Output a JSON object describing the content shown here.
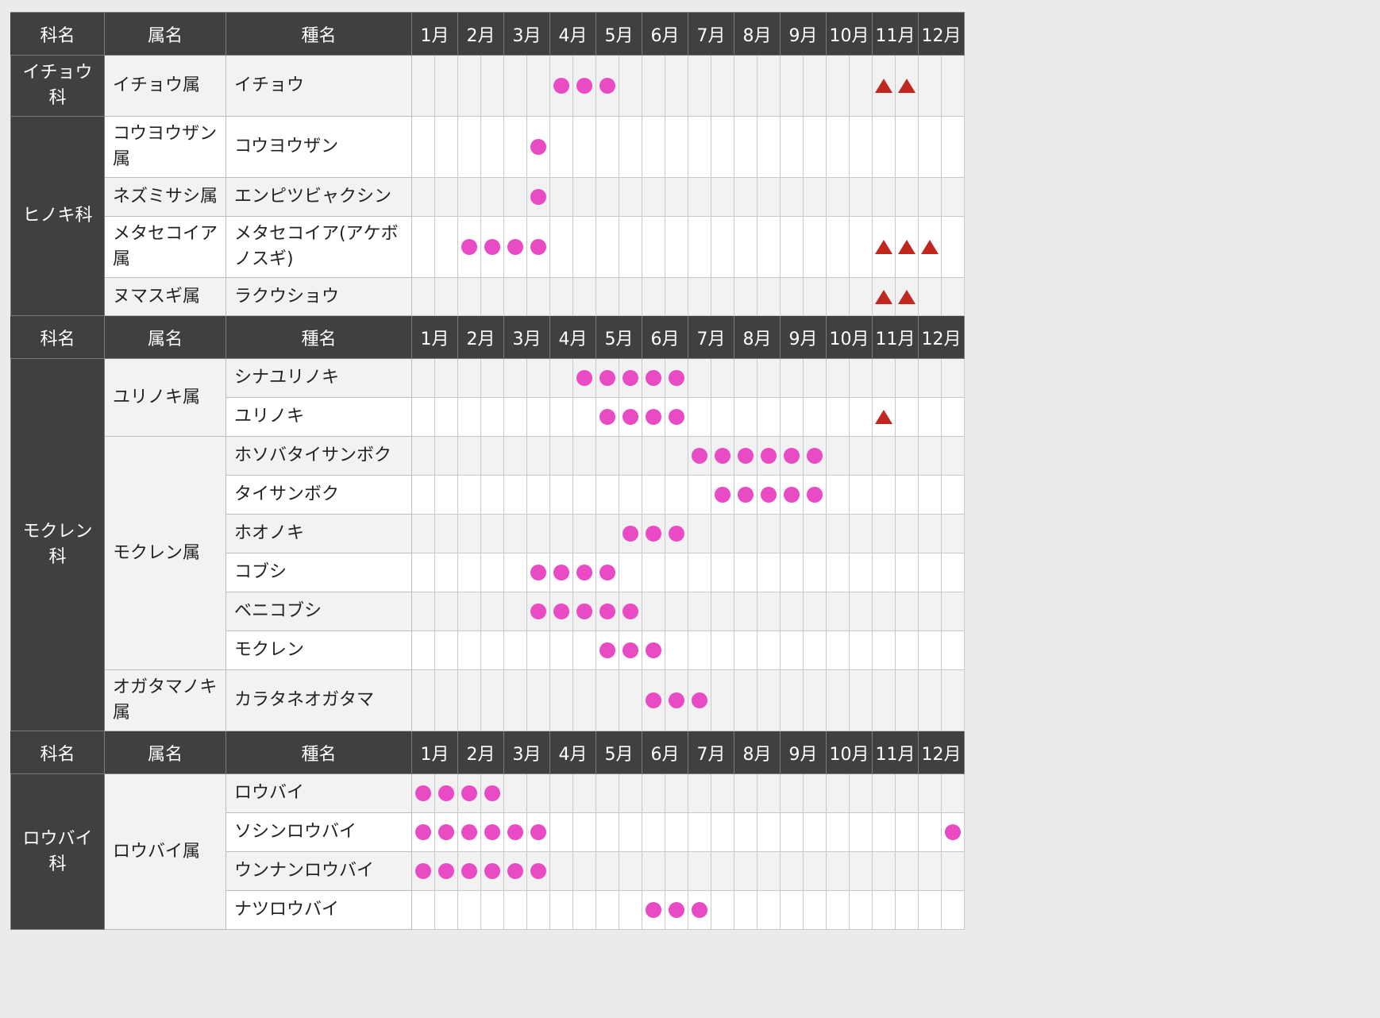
{
  "header": {
    "family": "科名",
    "genus": "属名",
    "species": "種名",
    "months": [
      "1月",
      "2月",
      "3月",
      "4月",
      "5月",
      "6月",
      "7月",
      "8月",
      "9月",
      "10月",
      "11月",
      "12月"
    ]
  },
  "legend_marks": {
    "flower": "pink-dot",
    "autumn_leaves": "red-triangle"
  },
  "colors": {
    "flower_mark": "#e84bc4",
    "leaf_mark": "#c0271f",
    "header_bg": "#404040"
  },
  "groups": [
    {
      "families": [
        {
          "name": "イチョウ科",
          "genera": [
            {
              "name": "イチョウ属",
              "species": [
                {
                  "name": "イチョウ",
                  "flowers": [
                    7,
                    8,
                    9
                  ],
                  "leaves": [
                    21,
                    22
                  ]
                }
              ]
            }
          ]
        },
        {
          "name": "ヒノキ科",
          "genera": [
            {
              "name": "コウヨウザン属",
              "species": [
                {
                  "name": "コウヨウザン",
                  "flowers": [
                    6
                  ],
                  "leaves": []
                }
              ]
            },
            {
              "name": "ネズミサシ属",
              "species": [
                {
                  "name": "エンピツビャクシン",
                  "flowers": [
                    6
                  ],
                  "leaves": []
                }
              ]
            },
            {
              "name": "メタセコイア属",
              "species": [
                {
                  "name": "メタセコイア(アケボノスギ)",
                  "flowers": [
                    3,
                    4,
                    5,
                    6
                  ],
                  "leaves": [
                    21,
                    22,
                    23
                  ]
                }
              ]
            },
            {
              "name": "ヌマスギ属",
              "species": [
                {
                  "name": "ラクウショウ",
                  "flowers": [],
                  "leaves": [
                    21,
                    22
                  ]
                }
              ]
            }
          ]
        }
      ]
    },
    {
      "families": [
        {
          "name": "モクレン科",
          "genera": [
            {
              "name": "ユリノキ属",
              "species": [
                {
                  "name": "シナユリノキ",
                  "flowers": [
                    8,
                    9,
                    10,
                    11,
                    12
                  ],
                  "leaves": []
                },
                {
                  "name": "ユリノキ",
                  "flowers": [
                    9,
                    10,
                    11,
                    12
                  ],
                  "leaves": [
                    21
                  ]
                }
              ]
            },
            {
              "name": "モクレン属",
              "species": [
                {
                  "name": "ホソバタイサンボク",
                  "flowers": [
                    13,
                    14,
                    15,
                    16,
                    17,
                    18
                  ],
                  "leaves": []
                },
                {
                  "name": "タイサンボク",
                  "flowers": [
                    14,
                    15,
                    16,
                    17,
                    18
                  ],
                  "leaves": []
                },
                {
                  "name": "ホオノキ",
                  "flowers": [
                    10,
                    11,
                    12
                  ],
                  "leaves": []
                },
                {
                  "name": "コブシ",
                  "flowers": [
                    6,
                    7,
                    8,
                    9
                  ],
                  "leaves": []
                },
                {
                  "name": "ベニコブシ",
                  "flowers": [
                    6,
                    7,
                    8,
                    9,
                    10
                  ],
                  "leaves": []
                },
                {
                  "name": "モクレン",
                  "flowers": [
                    9,
                    10,
                    11
                  ],
                  "leaves": []
                }
              ]
            },
            {
              "name": "オガタマノキ属",
              "species": [
                {
                  "name": "カラタネオガタマ",
                  "flowers": [
                    11,
                    12,
                    13
                  ],
                  "leaves": []
                }
              ]
            }
          ]
        }
      ]
    },
    {
      "families": [
        {
          "name": "ロウバイ科",
          "genera": [
            {
              "name": "ロウバイ属",
              "species": [
                {
                  "name": "ロウバイ",
                  "flowers": [
                    1,
                    2,
                    3,
                    4
                  ],
                  "leaves": []
                },
                {
                  "name": "ソシンロウバイ",
                  "flowers": [
                    1,
                    2,
                    3,
                    4,
                    5,
                    6,
                    24
                  ],
                  "leaves": []
                },
                {
                  "name": "ウンナンロウバイ",
                  "flowers": [
                    1,
                    2,
                    3,
                    4,
                    5,
                    6
                  ],
                  "leaves": []
                },
                {
                  "name": "ナツロウバイ",
                  "flowers": [
                    11,
                    12,
                    13
                  ],
                  "leaves": []
                }
              ]
            }
          ]
        }
      ]
    }
  ]
}
